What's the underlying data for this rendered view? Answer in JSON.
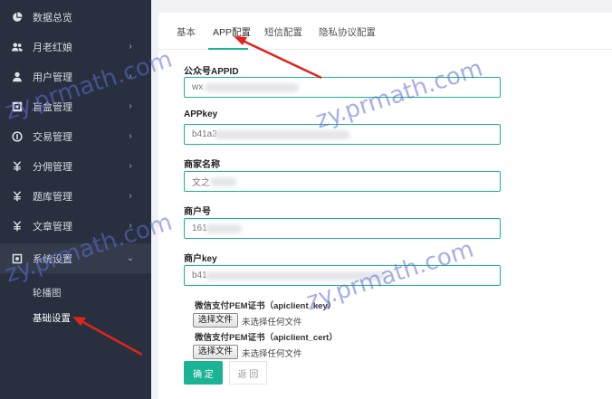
{
  "sidebar": {
    "items": [
      {
        "label": "数据总览",
        "icon": "pie-chart-icon",
        "chevron": ""
      },
      {
        "label": "月老红娘",
        "icon": "users-icon",
        "chevron": "›"
      },
      {
        "label": "用户管理",
        "icon": "user-icon",
        "chevron": "›"
      },
      {
        "label": "盲盒管理",
        "icon": "box-icon",
        "chevron": "›"
      },
      {
        "label": "交易管理",
        "icon": "coin-icon",
        "chevron": "›"
      },
      {
        "label": "分佣管理",
        "icon": "yen-icon",
        "chevron": "›"
      },
      {
        "label": "题库管理",
        "icon": "yen-icon",
        "chevron": "›"
      },
      {
        "label": "文章管理",
        "icon": "yen-icon",
        "chevron": "›"
      },
      {
        "label": "系统设置",
        "icon": "settings-icon",
        "chevron": "⌄"
      }
    ],
    "sub_items": [
      {
        "label": "轮播图"
      },
      {
        "label": "基础设置"
      }
    ]
  },
  "tabs": [
    {
      "label": "基本"
    },
    {
      "label": "APP配置"
    },
    {
      "label": "短信配置"
    },
    {
      "label": "隐私协议配置"
    }
  ],
  "form": {
    "appid": {
      "label": "公众号APPID",
      "value": "wx"
    },
    "appkey": {
      "label": "APPkey",
      "value": "b41a3"
    },
    "merchant_name": {
      "label": "商家名称",
      "value": "文之"
    },
    "merchant_id": {
      "label": "商户号",
      "value": "161"
    },
    "merchant_key": {
      "label": "商户key",
      "value": "b41"
    }
  },
  "files": [
    {
      "label": "微信支付PEM证书（apiclient_key）",
      "button": "选择文件",
      "status": "未选择任何文件"
    },
    {
      "label": "微信支付PEM证书（apiclient_cert）",
      "button": "选择文件",
      "status": "未选择任何文件"
    }
  ],
  "actions": {
    "confirm": "确 定",
    "back": "返 回"
  },
  "watermark": "zy.prmath.com",
  "colors": {
    "accent": "#1ab394",
    "sidebar": "#28303f",
    "arrow": "#e2231a"
  }
}
